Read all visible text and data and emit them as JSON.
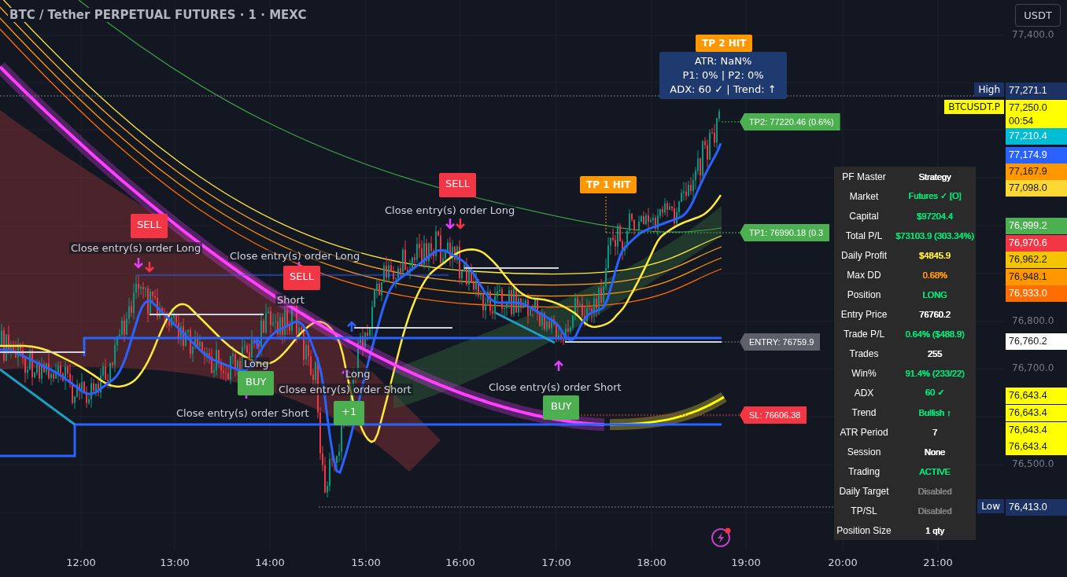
{
  "title": "BTC / Tether PERPETUAL FUTURES · 1 · MEXC",
  "currency_button": "USDT",
  "info_box": {
    "lines": [
      "ATR: NaN%",
      "P1: 0% | P2: 0%",
      "ADX: 60 ✓ | Trend: ↑"
    ]
  },
  "chart_labels": [
    {
      "kind": "sell",
      "text": "SELL"
    },
    {
      "kind": "note",
      "text": "Close entry(s) order Long"
    },
    {
      "kind": "note",
      "text": "Close entry(s) order Long"
    },
    {
      "kind": "sell",
      "text": "SELL"
    },
    {
      "kind": "note",
      "text": "Short"
    },
    {
      "kind": "sell",
      "text": "SELL"
    },
    {
      "kind": "note",
      "text": "Close entry(s) order Long"
    },
    {
      "kind": "note",
      "text": "Long"
    },
    {
      "kind": "buy",
      "text": "BUY"
    },
    {
      "kind": "note",
      "text": "Close entry(s) order Short"
    },
    {
      "kind": "note",
      "text": "Long"
    },
    {
      "kind": "note",
      "text": "Close entry(s) order Short"
    },
    {
      "kind": "buy",
      "text": "+1"
    },
    {
      "kind": "note",
      "text": "Close entry(s) order Short"
    },
    {
      "kind": "buy",
      "text": "BUY"
    },
    {
      "kind": "hit",
      "text": "TP 1 HIT"
    },
    {
      "kind": "hit",
      "text": "TP 2 HIT"
    }
  ],
  "price_tags": [
    {
      "text": "TP2: 77220.46 (0.6%)",
      "color": "#4caf50"
    },
    {
      "text": "TP1: 76990.18 (0.3",
      "color": "#4caf50"
    },
    {
      "text": "ENTRY: 76759.9",
      "color": "#5d606b"
    },
    {
      "text": "SL: 76606.38",
      "color": "#f23645"
    }
  ],
  "price_axis": {
    "ticks": [
      "77,400.0",
      "76,800.0",
      "76,700.0",
      "76,500.0"
    ],
    "badges": [
      {
        "tag": "High",
        "value": "77,271.1",
        "color": "#1c3264"
      },
      {
        "tag": "BTCUSDT.P",
        "value": "77,250.0",
        "sub": "00:54",
        "color": "#ffff00"
      },
      {
        "value": "77,210.4",
        "color": "#00bcd4"
      },
      {
        "value": "77,174.9",
        "color": "#2962ff"
      },
      {
        "value": "77,167.9",
        "color": "#ff9800"
      },
      {
        "value": "77,098.0",
        "color": "#fdd835"
      },
      {
        "value": "76,999.2",
        "color": "#4caf50"
      },
      {
        "value": "76,970.6",
        "color": "#f23645"
      },
      {
        "value": "76,962.2",
        "color": "#f5c400"
      },
      {
        "value": "76,948.1",
        "color": "#ff9800"
      },
      {
        "value": "76,933.0",
        "color": "#ff6d00"
      },
      {
        "value": "76,760.2",
        "color": "#ffffff"
      },
      {
        "value": "76,643.4",
        "color": "#ffff00"
      },
      {
        "value": "76,643.4",
        "color": "#ffff00"
      },
      {
        "value": "76,643.4",
        "color": "#ffff00"
      },
      {
        "value": "76,643.4",
        "color": "#ffff00"
      },
      {
        "tag": "Low",
        "value": "76,413.0",
        "color": "#1c3264"
      }
    ]
  },
  "stats_table": {
    "rows": [
      {
        "label": "PF Master",
        "value": "Strategy",
        "color": "#ffffff"
      },
      {
        "label": "Market",
        "value": "Futures ✓ [O]",
        "color": "#00e676"
      },
      {
        "label": "Capital",
        "value": "$97204.4",
        "color": "#00e676"
      },
      {
        "label": "Total P/L",
        "value": "$73103.9 (303.34%)",
        "color": "#00e676"
      },
      {
        "label": "Daily Profit",
        "value": "$4845.9",
        "color": "#ffeb3b"
      },
      {
        "label": "Max DD",
        "value": "0.68%",
        "color": "#ff9800"
      },
      {
        "label": "Position",
        "value": "LONG",
        "color": "#00e676"
      },
      {
        "label": "Entry Price",
        "value": "76760.2",
        "color": "#ffffff"
      },
      {
        "label": "Trade P/L",
        "value": "0.64% ($488.9)",
        "color": "#00e676"
      },
      {
        "label": "Trades",
        "value": "255",
        "color": "#ffffff"
      },
      {
        "label": "Win%",
        "value": "91.4% (233/22)",
        "color": "#00e676"
      },
      {
        "label": "ADX",
        "value": "60 ✓",
        "color": "#00e676"
      },
      {
        "label": "Trend",
        "value": "Bullish ↑",
        "color": "#00e676"
      },
      {
        "label": "ATR Period",
        "value": "7",
        "color": "#ffffff"
      },
      {
        "label": "Session",
        "value": "None",
        "color": "#ffffff"
      },
      {
        "label": "Trading",
        "value": "ACTIVE",
        "color": "#00e676"
      },
      {
        "label": "Daily Target",
        "value": "Disabled",
        "color": "#808080"
      },
      {
        "label": "TP/SL",
        "value": "Disabled",
        "color": "#808080"
      },
      {
        "label": "Position Size",
        "value": "1 qty",
        "color": "#ffffff"
      }
    ]
  },
  "time_axis": [
    "12:00",
    "13:00",
    "14:00",
    "15:00",
    "16:00",
    "17:00",
    "18:00",
    "19:00",
    "20:00",
    "21:00"
  ]
}
